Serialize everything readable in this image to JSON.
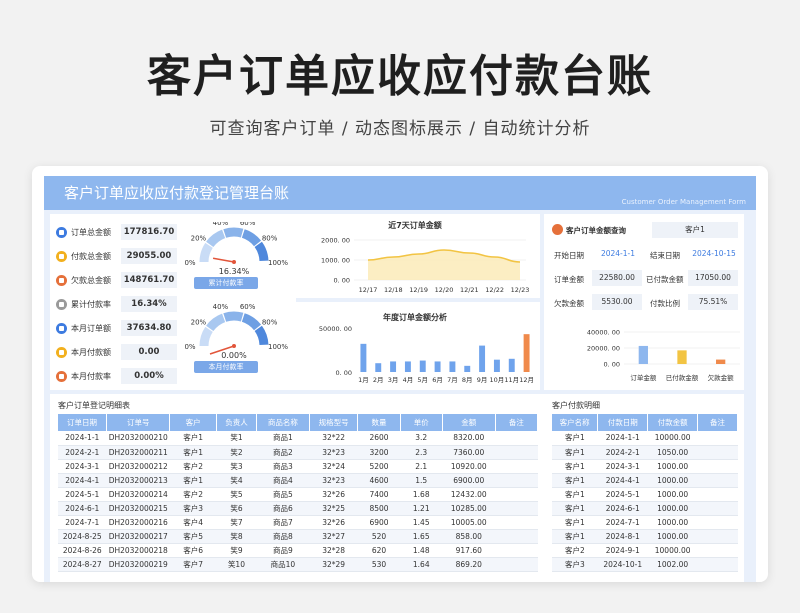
{
  "hero": {
    "title": "客户订单应收应付款台账",
    "subtitle": "可查询客户订单 / 动态图标展示 / 自动统计分析"
  },
  "banner": {
    "title": "客户订单应收应付款登记管理台账",
    "subtitle_en": "Customer Order Management Form"
  },
  "kpis": [
    {
      "label": "订单总金额",
      "value": "177816.70",
      "color": "#3d7be0"
    },
    {
      "label": "付款总金额",
      "value": "29055.00",
      "color": "#f2b01e"
    },
    {
      "label": "欠款总金额",
      "value": "148761.70",
      "color": "#e5703a"
    },
    {
      "label": "累计付款率",
      "value": "16.34%",
      "color": "#9a9a9a"
    },
    {
      "label": "本月订单额",
      "value": "37634.80",
      "color": "#3d7be0"
    },
    {
      "label": "本月付款额",
      "value": "0.00",
      "color": "#f2b01e"
    },
    {
      "label": "本月付款率",
      "value": "0.00%",
      "color": "#e5703a"
    }
  ],
  "gauges": [
    {
      "value_text": "16.34%",
      "value": 0.1634,
      "button": "累计付款率",
      "ticks": [
        "0%",
        "20%",
        "40%",
        "60%",
        "80%",
        "100%"
      ]
    },
    {
      "value_text": "0.00%",
      "value": 0.0,
      "button": "本月付款率",
      "ticks": [
        "0%",
        "20%",
        "40%",
        "60%",
        "80%",
        "100%"
      ]
    }
  ],
  "query": {
    "title": "客户订单金额查询",
    "customer": "客户1",
    "start_label": "开始日期",
    "start": "2024-1-1",
    "end_label": "结束日期",
    "end": "2024-10-15",
    "order_label": "订单金额",
    "order": "22580.00",
    "paid_label": "已付款金额",
    "paid": "17050.00",
    "owe_label": "欠款金额",
    "owe": "5530.00",
    "ratio_label": "付款比例",
    "ratio": "75.51%"
  },
  "chart_data": [
    {
      "type": "area",
      "title": "近7天订单金额",
      "categories": [
        "12/17",
        "12/18",
        "12/19",
        "12/20",
        "12/21",
        "12/22",
        "12/23"
      ],
      "values": [
        1000,
        1150,
        1300,
        1500,
        1350,
        1150,
        900
      ],
      "yticks": [
        "2000. 00",
        "1000. 00",
        "0. 00"
      ],
      "ylim": [
        0,
        2000
      ],
      "color": "#f2c443"
    },
    {
      "type": "bar",
      "title": "年度订单金额分析",
      "categories": [
        "1月",
        "2月",
        "3月",
        "4月",
        "5月",
        "6月",
        "7月",
        "8月",
        "9月",
        "10月",
        "11月",
        "12月"
      ],
      "values": [
        32000,
        10000,
        12000,
        12000,
        13000,
        12000,
        12000,
        7000,
        30000,
        14000,
        15000,
        43000
      ],
      "highlight_color": "#f08a4b",
      "color": "#6fa3ec",
      "yticks": [
        "50000. 00",
        "0. 00"
      ],
      "ylim": [
        0,
        50000
      ]
    },
    {
      "type": "bar",
      "title": "",
      "categories": [
        "订单金额",
        "已付款金额",
        "欠款金额"
      ],
      "values": [
        22580,
        17050,
        5530
      ],
      "colors": [
        "#8eb7ee",
        "#f2c443",
        "#f08a4b"
      ],
      "yticks": [
        "40000. 00",
        "20000. 00",
        "0. 00"
      ],
      "ylim": [
        0,
        40000
      ]
    }
  ],
  "orders": {
    "title": "客户订单登记明细表",
    "headers": [
      "订单日期",
      "订单号",
      "客户",
      "负责人",
      "商品名称",
      "规格型号",
      "数量",
      "单价",
      "金额",
      "备注"
    ],
    "rows": [
      [
        "2024-1-1",
        "DH2032000210",
        "客户1",
        "笑1",
        "商品1",
        "32*22",
        "2600",
        "3.2",
        "8320.00",
        ""
      ],
      [
        "2024-2-1",
        "DH2032000211",
        "客户1",
        "笑2",
        "商品2",
        "32*23",
        "3200",
        "2.3",
        "7360.00",
        ""
      ],
      [
        "2024-3-1",
        "DH2032000212",
        "客户2",
        "笑3",
        "商品3",
        "32*24",
        "5200",
        "2.1",
        "10920.00",
        ""
      ],
      [
        "2024-4-1",
        "DH2032000213",
        "客户1",
        "笑4",
        "商品4",
        "32*23",
        "4600",
        "1.5",
        "6900.00",
        ""
      ],
      [
        "2024-5-1",
        "DH2032000214",
        "客户2",
        "笑5",
        "商品5",
        "32*26",
        "7400",
        "1.68",
        "12432.00",
        ""
      ],
      [
        "2024-6-1",
        "DH2032000215",
        "客户3",
        "笑6",
        "商品6",
        "32*25",
        "8500",
        "1.21",
        "10285.00",
        ""
      ],
      [
        "2024-7-1",
        "DH2032000216",
        "客户4",
        "笑7",
        "商品7",
        "32*26",
        "6900",
        "1.45",
        "10005.00",
        ""
      ],
      [
        "2024-8-25",
        "DH2032000217",
        "客户5",
        "笑8",
        "商品8",
        "32*27",
        "520",
        "1.65",
        "858.00",
        ""
      ],
      [
        "2024-8-26",
        "DH2032000218",
        "客户6",
        "笑9",
        "商品9",
        "32*28",
        "620",
        "1.48",
        "917.60",
        ""
      ],
      [
        "2024-8-27",
        "DH2032000219",
        "客户7",
        "笑10",
        "商品10",
        "32*29",
        "530",
        "1.64",
        "869.20",
        ""
      ]
    ]
  },
  "payments": {
    "title": "客户付款明细",
    "headers": [
      "客户名称",
      "付款日期",
      "付款金额",
      "备注"
    ],
    "rows": [
      [
        "客户1",
        "2024-1-1",
        "10000.00",
        ""
      ],
      [
        "客户1",
        "2024-2-1",
        "1050.00",
        ""
      ],
      [
        "客户1",
        "2024-3-1",
        "1000.00",
        ""
      ],
      [
        "客户1",
        "2024-4-1",
        "1000.00",
        ""
      ],
      [
        "客户1",
        "2024-5-1",
        "1000.00",
        ""
      ],
      [
        "客户1",
        "2024-6-1",
        "1000.00",
        ""
      ],
      [
        "客户1",
        "2024-7-1",
        "1000.00",
        ""
      ],
      [
        "客户1",
        "2024-8-1",
        "1000.00",
        ""
      ],
      [
        "客户2",
        "2024-9-1",
        "10000.00",
        ""
      ],
      [
        "客户3",
        "2024-10-1",
        "1002.00",
        ""
      ]
    ]
  }
}
